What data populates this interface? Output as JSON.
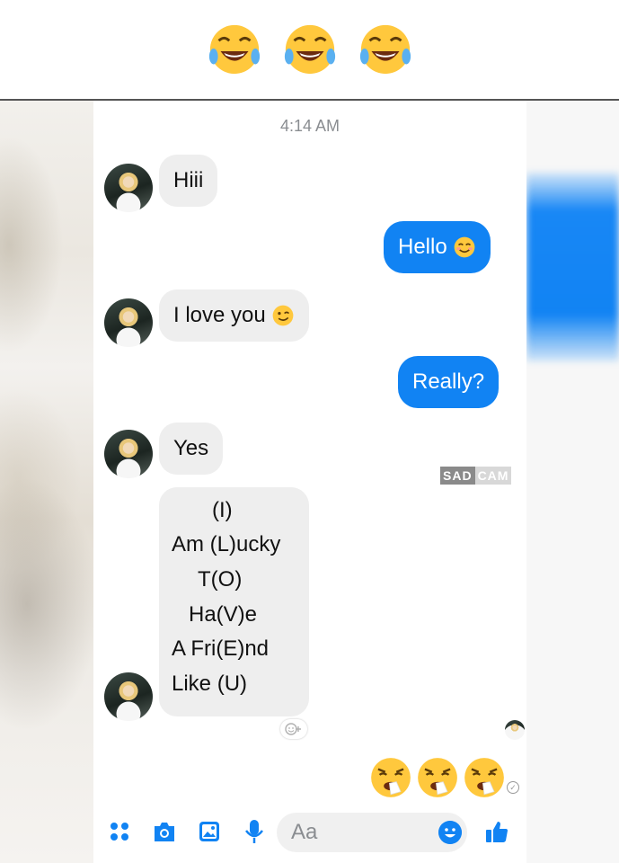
{
  "header": {
    "emojis": [
      "face-with-tears-of-joy",
      "face-with-tears-of-joy",
      "face-with-tears-of-joy"
    ]
  },
  "chat": {
    "timestamp": "4:14 AM",
    "messages": [
      {
        "from": "them",
        "text": "Hiii"
      },
      {
        "from": "me",
        "text": "Hello",
        "emoji": "smiling-face-with-smiling-eyes"
      },
      {
        "from": "them",
        "text": "I love you",
        "emoji": "winking-face"
      },
      {
        "from": "me",
        "text": "Really?"
      },
      {
        "from": "them",
        "text": "Yes"
      },
      {
        "from": "them",
        "lines": [
          "(I)",
          "Am (L)ucky",
          "T(O)",
          "Ha(V)e",
          "A Fri(E)nd",
          "Like (U)"
        ]
      }
    ],
    "stickers": [
      "face-with-steam-and-tissue",
      "face-with-steam-and-tissue",
      "face-with-steam-and-tissue"
    ],
    "watermark": {
      "part1": "SAD",
      "part2": "CAM"
    }
  },
  "composer": {
    "placeholder": "Aa",
    "icons": [
      "menu-dots-icon",
      "camera-icon",
      "gallery-icon",
      "microphone-icon",
      "emoji-icon",
      "thumbs-up-icon"
    ]
  },
  "colors": {
    "accent": "#1183f3",
    "incoming_bubble": "#eeeeee",
    "icon_blue": "#1183f3"
  }
}
